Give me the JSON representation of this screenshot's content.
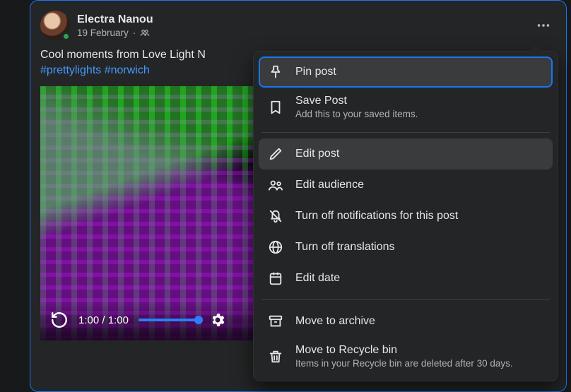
{
  "post": {
    "author_name": "Electra Nanou",
    "date": "19 February",
    "text_plain": "Cool moments from Love Light N",
    "hashtags": [
      "#prettylights",
      "#norwich"
    ]
  },
  "video": {
    "current_time": "1:00",
    "duration": "1:00"
  },
  "menu": {
    "pin": {
      "label": "Pin post"
    },
    "save": {
      "label": "Save Post",
      "sub": "Add this to your saved items."
    },
    "edit_post": {
      "label": "Edit post"
    },
    "edit_audience": {
      "label": "Edit audience"
    },
    "turn_off_notifications": {
      "label": "Turn off notifications for this post"
    },
    "turn_off_translations": {
      "label": "Turn off translations"
    },
    "edit_date": {
      "label": "Edit date"
    },
    "move_archive": {
      "label": "Move to archive"
    },
    "move_recycle": {
      "label": "Move to Recycle bin",
      "sub": "Items in your Recycle bin are deleted after 30 days."
    }
  }
}
